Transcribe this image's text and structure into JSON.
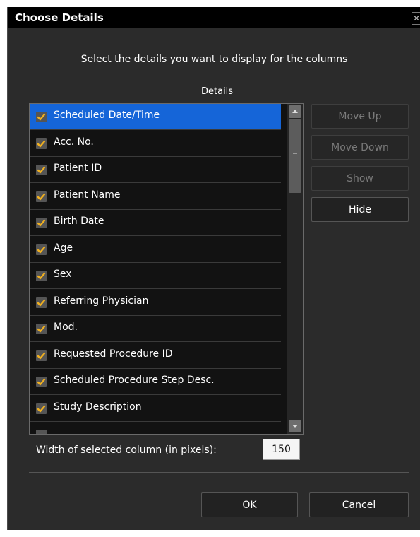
{
  "window": {
    "title": "Choose Details",
    "close_glyph": "✕"
  },
  "instruction": "Select the details you want to display for the columns",
  "details_label": "Details",
  "list": {
    "items": [
      {
        "label": "Scheduled Date/Time",
        "checked": true,
        "selected": true
      },
      {
        "label": "Acc. No.",
        "checked": true
      },
      {
        "label": "Patient ID",
        "checked": true
      },
      {
        "label": "Patient Name",
        "checked": true
      },
      {
        "label": "Birth Date",
        "checked": true
      },
      {
        "label": "Age",
        "checked": true
      },
      {
        "label": "Sex",
        "checked": true
      },
      {
        "label": "Referring Physician",
        "checked": true
      },
      {
        "label": "Mod.",
        "checked": true
      },
      {
        "label": "Requested Procedure ID",
        "checked": true
      },
      {
        "label": "Scheduled Procedure Step Desc.",
        "checked": true
      },
      {
        "label": "Study Description",
        "checked": true
      }
    ]
  },
  "buttons": {
    "move_up": "Move Up",
    "move_down": "Move Down",
    "show": "Show",
    "hide": "Hide",
    "ok": "OK",
    "cancel": "Cancel"
  },
  "width": {
    "label": "Width of selected column (in pixels):",
    "value": "150"
  },
  "colors": {
    "checkmark": "#f0b020",
    "selection": "#1565d8",
    "background": "#2b2b2b"
  },
  "icons": {
    "checkbox": "check-icon",
    "close": "close-icon"
  }
}
